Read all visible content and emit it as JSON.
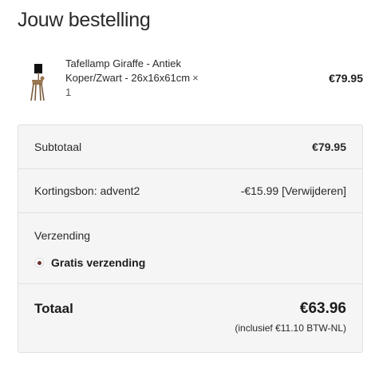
{
  "page": {
    "title": "Jouw bestelling"
  },
  "product": {
    "name": "Tafellamp Giraffe - Antiek Koper/Zwart - 26x16x61cm",
    "quantity": "× 1",
    "price": "€79.95",
    "image_icon": "giraffe-lamp-thumbnail"
  },
  "summary": {
    "subtotal_label": "Subtotaal",
    "subtotal_value": "€79.95",
    "coupon_label": "Kortingsbon: advent2",
    "coupon_value": "-€15.99",
    "coupon_remove": "[Verwijderen]",
    "shipping_label": "Verzending",
    "shipping_option": "Gratis verzending",
    "total_label": "Totaal",
    "total_value": "€63.96",
    "tax_note": "(inclusief €11.10 BTW-NL)"
  },
  "colors": {
    "accent": "#6b2f2a",
    "panel_bg": "#f6f5f5",
    "border": "#e2e0e0"
  }
}
